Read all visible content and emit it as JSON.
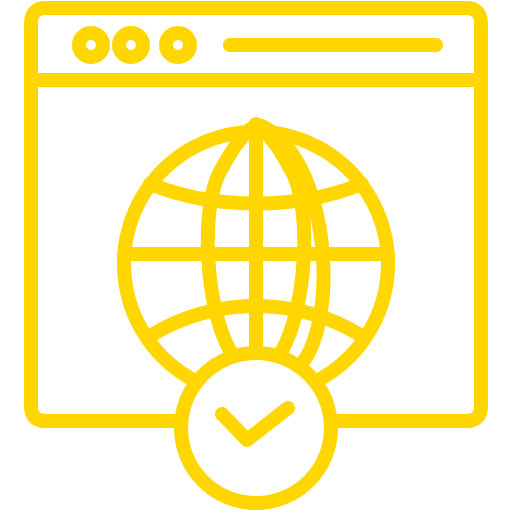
{
  "icon": {
    "name": "web-globe-verified-icon",
    "parts": [
      "browser-window-icon",
      "globe-icon",
      "checkmark-badge-icon"
    ],
    "color": "#FFD600",
    "background": "#FFFFFF"
  }
}
